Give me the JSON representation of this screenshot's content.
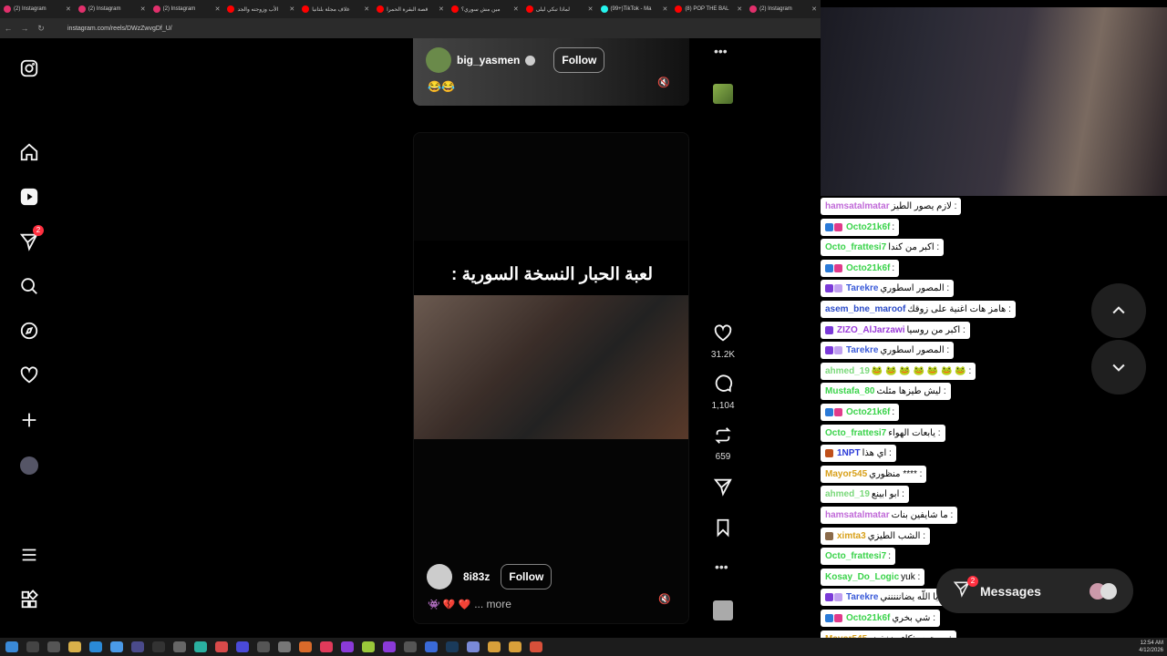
{
  "browser": {
    "tabs": [
      {
        "label": "(2) Instagram",
        "color": "#e1306c"
      },
      {
        "label": "(2) Instagram",
        "color": "#e1306c"
      },
      {
        "label": "(2) Instagram",
        "color": "#e1306c"
      },
      {
        "label": "الأب وزوجته والجد",
        "color": "#ff0000"
      },
      {
        "label": "غلاف مجلة بلتانيا",
        "color": "#ff0000"
      },
      {
        "label": "قصة البقرة الحمرا",
        "color": "#ff0000"
      },
      {
        "label": "مين مش سوري؟",
        "color": "#ff0000"
      },
      {
        "label": "لماذا تبكي ليلى",
        "color": "#ff0000"
      },
      {
        "label": "(99+)TikTok - Ma",
        "color": "#25f4ee"
      },
      {
        "label": "(8) POP THE BAL",
        "color": "#ff0000"
      },
      {
        "label": "(2) Instagram",
        "color": "#e1306c"
      }
    ],
    "url": "instagram.com/reels/DWzZwvgDf_U/"
  },
  "sidebar": {
    "notification_count": "2"
  },
  "post1": {
    "username": "big_yasmen",
    "follow": "Follow",
    "caption": "😂😂"
  },
  "post2": {
    "video_title": "لعبة الحبار النسخة السورية :",
    "username": "8i83z",
    "follow": "Follow",
    "caption_emojis": "👾 💔 ❤️",
    "more": "... more"
  },
  "actions": {
    "likes": "31.2K",
    "comments": "1,104",
    "reposts": "659"
  },
  "chat": [
    {
      "user": "hamsatalmatar",
      "text": ": لازم يصور الطيز",
      "color": "#c06ad8",
      "badges": []
    },
    {
      "user": "Octo21k6f",
      "text": ":",
      "color": "#3ad34a",
      "badges": [
        "#2a7ad8",
        "#e03a8a"
      ]
    },
    {
      "user": "Octo_frattesi7",
      "text": ": اكبر من كندا",
      "color": "#3ad34a",
      "badges": []
    },
    {
      "user": "Octo21k6f",
      "text": ":",
      "color": "#3ad34a",
      "badges": [
        "#2a7ad8",
        "#e03a8a"
      ]
    },
    {
      "user": "Tarekre",
      "text": ": المصور اسطوري",
      "color": "#3a5ad8",
      "badges": [
        "#7a3ad8",
        "#c0a0f0"
      ]
    },
    {
      "user": "asem_bne_maroof",
      "text": ": هامز هات اغنية على زوقك",
      "color": "#2a4ac8",
      "badges": []
    },
    {
      "user": "ZIZO_AlJarzawi",
      "text": ": اكبر من روسيا",
      "color": "#9a3ad8",
      "badges": [
        "#7a3ad8"
      ]
    },
    {
      "user": "Tarekre",
      "text": ": المصور اسطوري",
      "color": "#3a5ad8",
      "badges": [
        "#7a3ad8",
        "#c0a0f0"
      ]
    },
    {
      "user": "ahmed_19",
      "text": ": 🐸 🐸 🐸 🐸 🐸 🐸 🐸",
      "color": "#7ad87a",
      "badges": []
    },
    {
      "user": "Mustafa_80",
      "text": ": ليش طيزها مثلث",
      "color": "#3ad34a",
      "badges": []
    },
    {
      "user": "Octo21k6f",
      "text": ":",
      "color": "#3ad34a",
      "badges": [
        "#2a7ad8",
        "#e03a8a"
      ]
    },
    {
      "user": "Octo_frattesi7",
      "text": ": يابعات الهواء",
      "color": "#3ad34a",
      "badges": []
    },
    {
      "user": "1NPT",
      "text": ": اي هذا",
      "color": "#2a3ad8",
      "badges": [
        "#c0501a"
      ]
    },
    {
      "user": "Mayor545",
      "text": ": **** منظوري",
      "color": "#d8a01a",
      "badges": []
    },
    {
      "user": "ahmed_19",
      "text": ": ابو ابينع",
      "color": "#7ad87a",
      "badges": []
    },
    {
      "user": "hamsatalmatar",
      "text": ": ما شايفين بنات",
      "color": "#c06ad8",
      "badges": []
    },
    {
      "user": "ximta3",
      "text": ": الشب الطيزي",
      "color": "#d8a01a",
      "badges": [
        "#8a6a4a"
      ]
    },
    {
      "user": "Octo_frattesi7",
      "text": ":",
      "color": "#3ad34a",
      "badges": []
    },
    {
      "user": "Kosay_Do_Logic",
      "text": ": yuk",
      "color": "#3ad34a",
      "badges": []
    },
    {
      "user": "Tarekre",
      "text": ": يا اللّه يضاننننني",
      "color": "#3a5ad8",
      "badges": [
        "#7a3ad8",
        "#c0a0f0"
      ]
    },
    {
      "user": "Octo21k6f",
      "text": ": شي بخري",
      "color": "#3ad34a",
      "badges": [
        "#2a7ad8",
        "#e03a8a"
      ]
    },
    {
      "user": "Mayor545",
      "text": ": مستوى ذكاء منخفض",
      "color": "#d8a01a",
      "badges": []
    }
  ],
  "messages": {
    "label": "Messages",
    "count": "2"
  },
  "clock": {
    "time": "12:54 AM",
    "date": "4/12/2026"
  }
}
